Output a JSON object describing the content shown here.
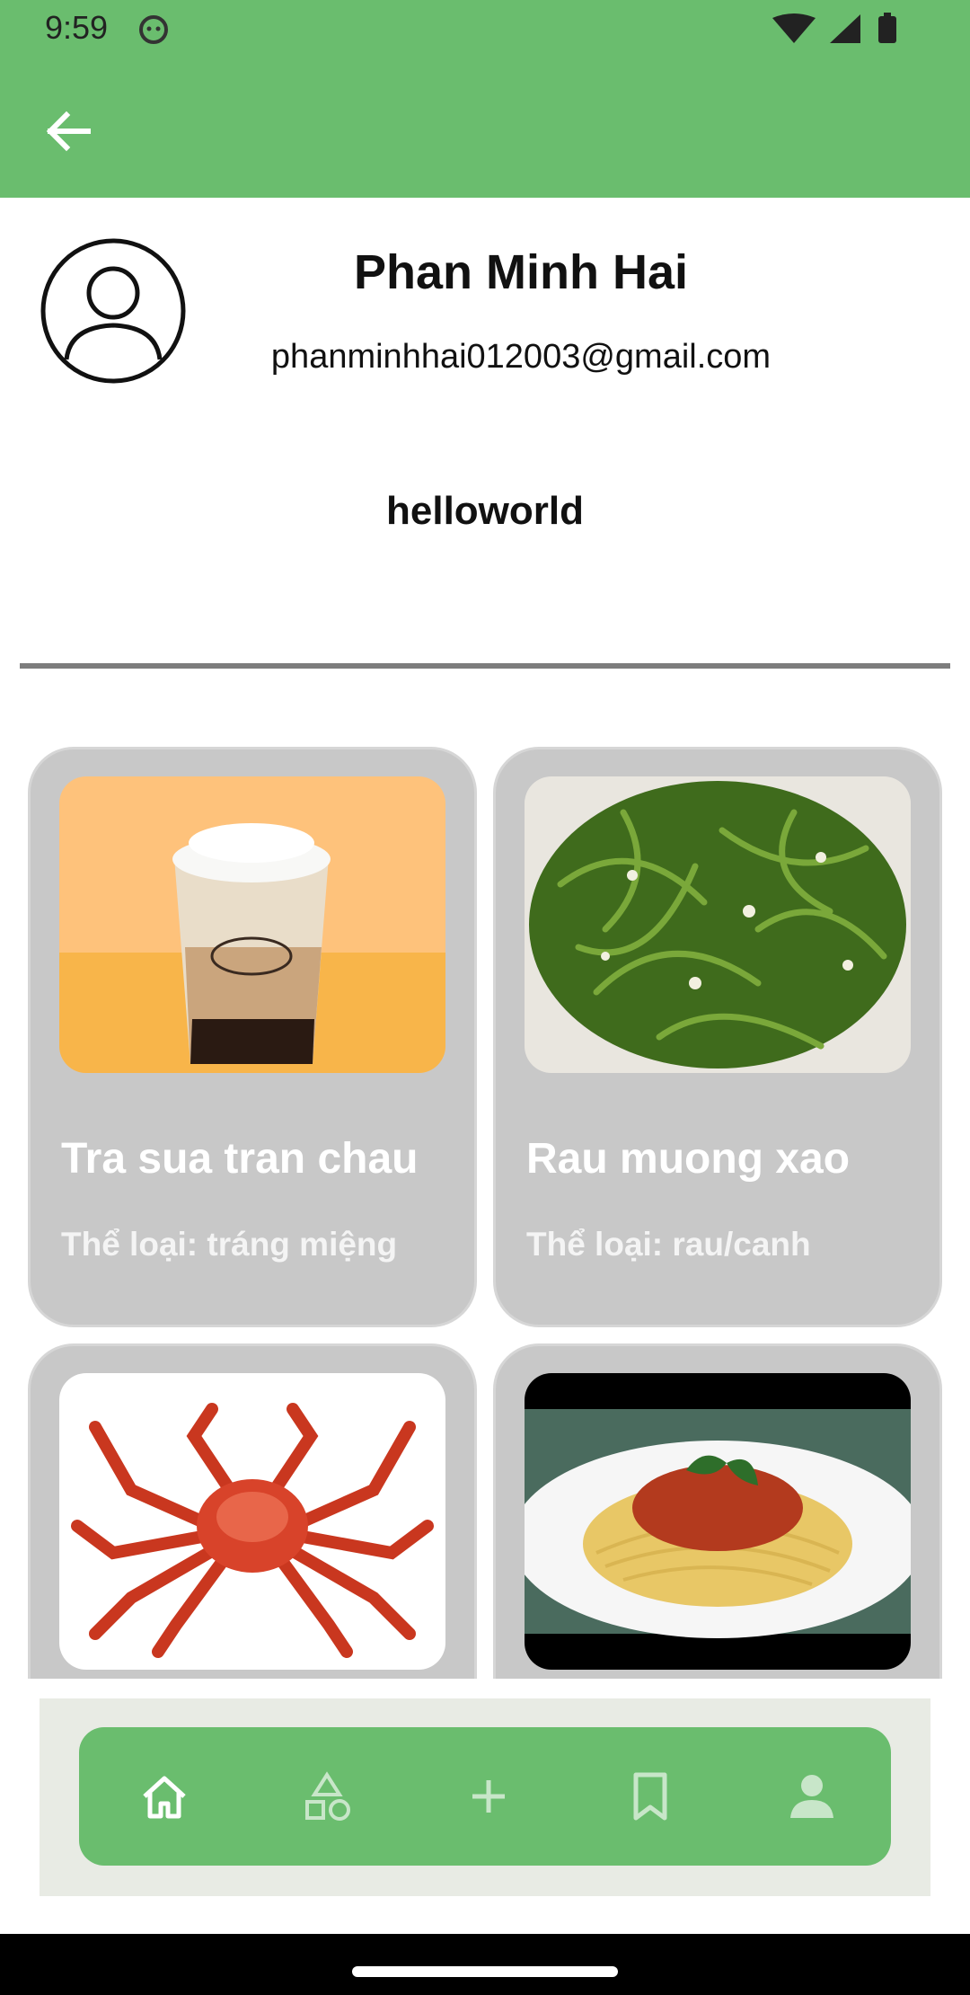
{
  "status_bar": {
    "time": "9:59"
  },
  "profile": {
    "name": "Phan Minh Hai",
    "email": "phanminhhai012003@gmail.com",
    "bio": "helloworld"
  },
  "recipes": [
    {
      "title": "Tra sua tran chau",
      "category": "Thể loại: tráng miệng",
      "image": "bubble-tea-image"
    },
    {
      "title": "Rau muong xao",
      "category": "Thể loại: rau/canh",
      "image": "water-spinach-image"
    },
    {
      "title": "",
      "category": "",
      "image": "king-crab-image"
    },
    {
      "title": "",
      "category": "",
      "image": "spaghetti-image"
    }
  ],
  "bottom_nav": {
    "items": [
      "home-icon",
      "categories-icon",
      "add-icon",
      "bookmark-icon",
      "profile-icon"
    ],
    "selected": "home-icon"
  },
  "colors": {
    "primary_green": "#6abd6e",
    "card_gray": "#c8c8c8",
    "nav_background": "#e8ebe4",
    "inactive_icon": "#c8e6c9"
  }
}
